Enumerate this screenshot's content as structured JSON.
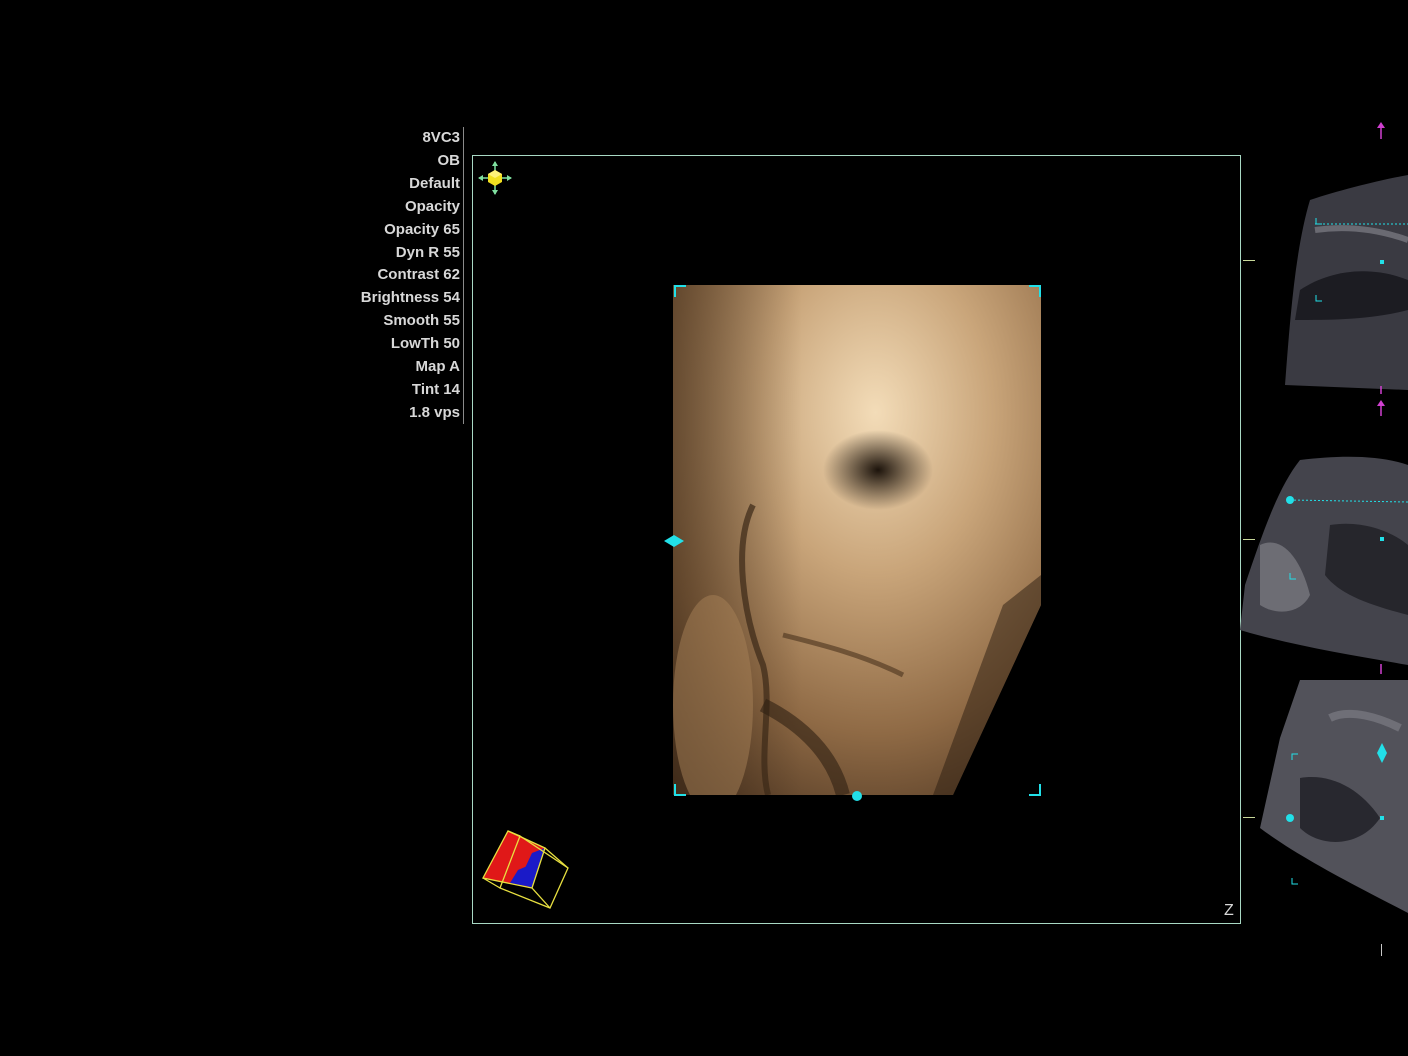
{
  "params": {
    "lines": [
      "8VC3",
      "OB",
      "Default",
      "Opacity",
      "Opacity 65",
      "Dyn R 55",
      "Contrast 62",
      "Brightness 54",
      "Smooth 55",
      "LowTh 50",
      "Map A",
      "Tint 14",
      "1.8 vps"
    ]
  },
  "viewport": {
    "axis_label": "Z",
    "frame_color": "#a8d8c4",
    "marker_color": "#22e0e8"
  },
  "icons": {
    "move": "move-tool-icon",
    "orientation": "orientation-cube-icon"
  }
}
